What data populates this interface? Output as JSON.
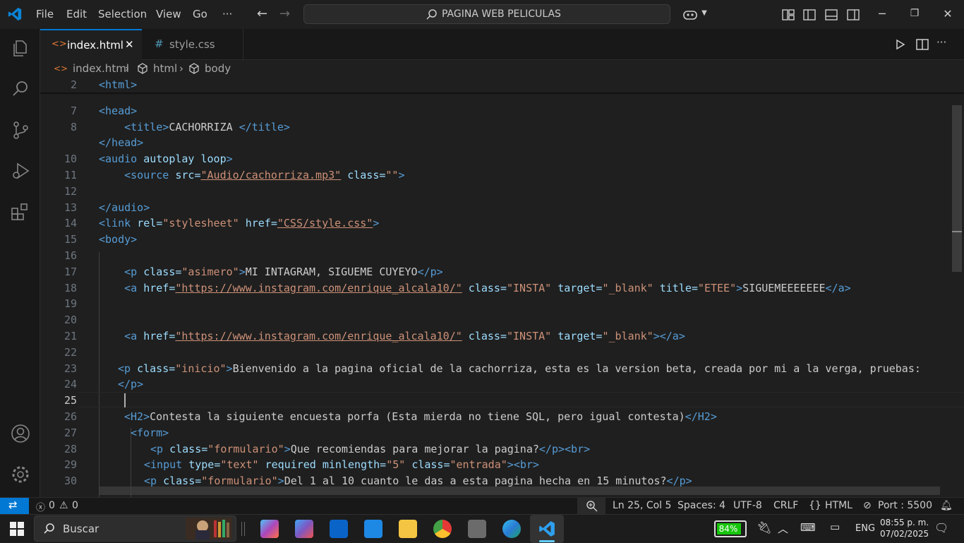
{
  "titlebar": {
    "menu": [
      "File",
      "Edit",
      "Selection",
      "View",
      "Go",
      "···"
    ],
    "search": "PAGINA WEB PELICULAS"
  },
  "tabs": [
    {
      "label": "index.html",
      "icon": "html-file-icon",
      "active": true,
      "close": "✕"
    },
    {
      "label": "style.css",
      "icon": "css-hash-icon",
      "active": false
    }
  ],
  "breadcrumb": [
    "index.html",
    "html",
    "body"
  ],
  "editor": {
    "cursor_line": 25,
    "lines": [
      {
        "n": "2"
      },
      {
        "n": "7"
      },
      {
        "n": "8"
      },
      {
        "n": "10"
      },
      {
        "n": "11"
      },
      {
        "n": "12"
      },
      {
        "n": "13"
      },
      {
        "n": "14"
      },
      {
        "n": "15"
      },
      {
        "n": "16"
      },
      {
        "n": "17"
      },
      {
        "n": "18"
      },
      {
        "n": "19"
      },
      {
        "n": "20"
      },
      {
        "n": "21"
      },
      {
        "n": "22"
      },
      {
        "n": "23"
      },
      {
        "n": "24"
      },
      {
        "n": "25"
      },
      {
        "n": "26"
      },
      {
        "n": "27"
      },
      {
        "n": "28"
      },
      {
        "n": "29"
      },
      {
        "n": "30"
      }
    ],
    "tokens": {
      "html_open": "<html>",
      "head_open": "<head>",
      "title_open": "<title>",
      "title_text": "CACHORRIZA ",
      "title_close": "</title>",
      "head_close": "</head>",
      "audio_open": "<audio",
      "autoplay": "autoplay",
      "loop": "loop",
      "gt": ">",
      "source_open": "<source",
      "src_attr": "src=",
      "src_val": "\"Audio/cachorriza.mp3\"",
      "class_attr": "class=",
      "class_empty": "\"\"",
      "audio_close": "</audio>",
      "link_open": "<link",
      "rel_attr": "rel=",
      "rel_val": "\"stylesheet\"",
      "href_attr": "href=",
      "href_css": "\"CSS/style.css\"",
      "body_open": "<body>",
      "p_open": "<p",
      "class_asimero": "\"asimero\"",
      "asimero_text": "MI INTAGRAM, SIGUEME CUYEYO",
      "p_close": "</p>",
      "a_open": "<a",
      "insta_url": "\"https://www.instagram.com/enrique_alcala10/\"",
      "class_insta": "\"INSTA\"",
      "target_attr": "target=",
      "target_val": "\"_blank\"",
      "title_attr": "title=",
      "title_val": "\"ETEE\"",
      "a_text": "SIGUEMEEEEEEE",
      "a_close": "</a>",
      "class_inicio": "\"inicio\"",
      "inicio_text": "Bienvenido a la pagina oficial de la cachorriza, esta es la version beta, creada por mi a la verga, pruebas:",
      "h2_open": "<H2>",
      "h2_text": "Contesta la siguiente encuesta porfa (Esta mierda no tiene SQL, pero igual contesta)",
      "h2_close": "</H2>",
      "form_open": "<form>",
      "class_formulario": "\"formulario\"",
      "q1_text": "Que recomiendas para mejorar la pagina?",
      "br": "<br>",
      "input_open": "<input",
      "type_attr": "type=",
      "type_val": "\"text\"",
      "required": "required",
      "minlength_attr": "minlength=",
      "minlength_val": "\"5\"",
      "class_entrada": "\"entrada\"",
      "q2_text": "Del 1 al 10 cuanto le das a esta pagina hecha en 15 minutos?"
    }
  },
  "statusbar": {
    "errors": "0",
    "warnings": "0",
    "position": "Ln 25, Col 5",
    "spaces": "Spaces: 4",
    "encoding": "UTF-8",
    "eol": "CRLF",
    "language": "HTML",
    "language_braces": "{}",
    "port": "Port : 5500"
  },
  "taskbar": {
    "search": "Buscar",
    "battery": "84%",
    "lang": "ENG",
    "time": "08:55 p. m.",
    "date": "07/02/2025"
  }
}
